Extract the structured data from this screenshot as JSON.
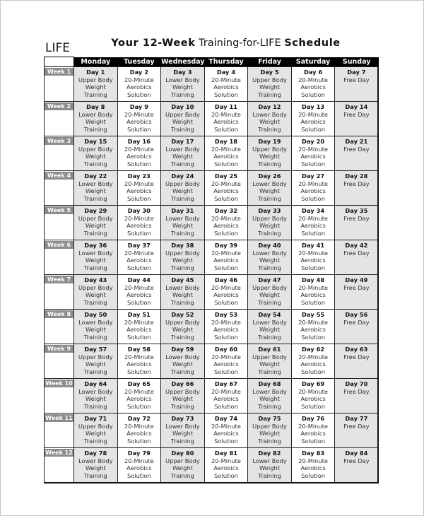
{
  "brand": "LIFE",
  "title": {
    "part1": "Your 12-Week",
    "part2": " Training-for-LIFE ",
    "part3": "Schedule"
  },
  "days_of_week": [
    "Monday",
    "Tuesday",
    "Wednesday",
    "Thursday",
    "Friday",
    "Saturday",
    "Sunday"
  ],
  "weeks": [
    {
      "label": "Week 1",
      "days": [
        {
          "day": "Day 1",
          "lines": [
            "Upper Body",
            "Weight",
            "Training"
          ]
        },
        {
          "day": "Day 2",
          "lines": [
            "20-Minute",
            "Aerobics",
            "Solution"
          ]
        },
        {
          "day": "Day 3",
          "lines": [
            "Lower Body",
            "Weight",
            "Training"
          ]
        },
        {
          "day": "Day 4",
          "lines": [
            "20-Minute",
            "Aerobics",
            "Solution"
          ]
        },
        {
          "day": "Day 5",
          "lines": [
            "Upper Body",
            "Weight",
            "Training"
          ]
        },
        {
          "day": "Day 6",
          "lines": [
            "20-Minute",
            "Aerobics",
            "Solution"
          ]
        },
        {
          "day": "Day 7",
          "lines": [
            "Free Day"
          ]
        }
      ]
    },
    {
      "label": "Week 2",
      "days": [
        {
          "day": "Day 8",
          "lines": [
            "Lower Body",
            "Weight",
            "Training"
          ]
        },
        {
          "day": "Day 9",
          "lines": [
            "20-Minute",
            "Aerobics",
            "Solution"
          ]
        },
        {
          "day": "Day 10",
          "lines": [
            "Upper Body",
            "Weight",
            "Training"
          ]
        },
        {
          "day": "Day 11",
          "lines": [
            "20-Minute",
            "Aerobics",
            "Solution"
          ]
        },
        {
          "day": "Day 12",
          "lines": [
            "Lower Body",
            "Weight",
            "Training"
          ]
        },
        {
          "day": "Day 13",
          "lines": [
            "20-Minute",
            "Aerobics",
            "Solution"
          ]
        },
        {
          "day": "Day 14",
          "lines": [
            "Free Day"
          ]
        }
      ]
    },
    {
      "label": "Week 3",
      "days": [
        {
          "day": "Day 15",
          "lines": [
            "Upper Body",
            "Weight",
            "Training"
          ]
        },
        {
          "day": "Day 16",
          "lines": [
            "20-Minute",
            "Aerobics",
            "Solution"
          ]
        },
        {
          "day": "Day 17",
          "lines": [
            "Lower Body",
            "Weight",
            "Training"
          ]
        },
        {
          "day": "Day 18",
          "lines": [
            "20-Minute",
            "Aerobics",
            "Solution"
          ]
        },
        {
          "day": "Day 19",
          "lines": [
            "Upper Body",
            "Weight",
            "Training"
          ]
        },
        {
          "day": "Day 20",
          "lines": [
            "20-Minute",
            "Aerobics",
            "Solution"
          ]
        },
        {
          "day": "Day 21",
          "lines": [
            "Free Day"
          ]
        }
      ]
    },
    {
      "label": "Week 4",
      "days": [
        {
          "day": "Day 22",
          "lines": [
            "Lower Body",
            "Weight",
            "Training"
          ]
        },
        {
          "day": "Day 23",
          "lines": [
            "20-Minute",
            "Aerobics",
            "Solution"
          ]
        },
        {
          "day": "Day 24",
          "lines": [
            "Upper Body",
            "Weight",
            "Training"
          ]
        },
        {
          "day": "Day 25",
          "lines": [
            "20-Minute",
            "Aerobics",
            "Solution"
          ]
        },
        {
          "day": "Day 26",
          "lines": [
            "Lower Body",
            "Weight",
            "Training"
          ]
        },
        {
          "day": "Day 27",
          "lines": [
            "20-Minute",
            "Aerobics",
            "Solution"
          ]
        },
        {
          "day": "Day 28",
          "lines": [
            "Free Day"
          ]
        }
      ]
    },
    {
      "label": "Week 5",
      "days": [
        {
          "day": "Day 29",
          "lines": [
            "Upper Body",
            "Weight",
            "Training"
          ]
        },
        {
          "day": "Day 30",
          "lines": [
            "20-Minute",
            "Aerobics",
            "Solution"
          ]
        },
        {
          "day": "Day 31",
          "lines": [
            "Lower Body",
            "Weight",
            "Training"
          ]
        },
        {
          "day": "Day 32",
          "lines": [
            "20-Minute",
            "Aerobics",
            "Solution"
          ]
        },
        {
          "day": "Day 33",
          "lines": [
            "Upper Body",
            "Weight",
            "Training"
          ]
        },
        {
          "day": "Day 34",
          "lines": [
            "20-Minute",
            "Aerobics",
            "Solution"
          ]
        },
        {
          "day": "Day 35",
          "lines": [
            "Free Day"
          ]
        }
      ]
    },
    {
      "label": "Week 6",
      "days": [
        {
          "day": "Day 36",
          "lines": [
            "Lower Body",
            "Weight",
            "Training"
          ]
        },
        {
          "day": "Day 37",
          "lines": [
            "20-Minute",
            "Aerobics",
            "Solution"
          ]
        },
        {
          "day": "Day 38",
          "lines": [
            "Upper Body",
            "Weight",
            "Training"
          ]
        },
        {
          "day": "Day 39",
          "lines": [
            "20-Minute",
            "Aerobics",
            "Solution"
          ]
        },
        {
          "day": "Day 40",
          "lines": [
            "Lower Body",
            "Weight",
            "Training"
          ]
        },
        {
          "day": "Day 41",
          "lines": [
            "20-Minute",
            "Aerobics",
            "Solution"
          ]
        },
        {
          "day": "Day 42",
          "lines": [
            "Free Day"
          ]
        }
      ]
    },
    {
      "label": "Week 7",
      "days": [
        {
          "day": "Day 43",
          "lines": [
            "Upper Body",
            "Weight",
            "Training"
          ]
        },
        {
          "day": "Day 44",
          "lines": [
            "20-Minute",
            "Aerobics",
            "Solution"
          ]
        },
        {
          "day": "Day 45",
          "lines": [
            "Lower Body",
            "Weight",
            "Training"
          ]
        },
        {
          "day": "Day 46",
          "lines": [
            "20-Minute",
            "Aerobics",
            "Solution"
          ]
        },
        {
          "day": "Day 47",
          "lines": [
            "Upper Body",
            "Weight",
            "Training"
          ]
        },
        {
          "day": "Day 48",
          "lines": [
            "20-Minute",
            "Aerobics",
            "Solution"
          ]
        },
        {
          "day": "Day 49",
          "lines": [
            "Free Day"
          ]
        }
      ]
    },
    {
      "label": "Week 8",
      "days": [
        {
          "day": "Day 50",
          "lines": [
            "Lower Body",
            "Weight",
            "Training"
          ]
        },
        {
          "day": "Day 51",
          "lines": [
            "20-Minute",
            "Aerobics",
            "Solution"
          ]
        },
        {
          "day": "Day 52",
          "lines": [
            "Upper Body",
            "Weight",
            "Training"
          ]
        },
        {
          "day": "Day 53",
          "lines": [
            "20-Minute",
            "Aerobics",
            "Solution"
          ]
        },
        {
          "day": "Day 54",
          "lines": [
            "Lower Body",
            "Weight",
            "Training"
          ]
        },
        {
          "day": "Day 55",
          "lines": [
            "20-Minute",
            "Aerobics",
            "Solution"
          ]
        },
        {
          "day": "Day 56",
          "lines": [
            "Free Day"
          ]
        }
      ]
    },
    {
      "label": "Week 9",
      "days": [
        {
          "day": "Day 57",
          "lines": [
            "Upper Body",
            "Weight",
            "Training"
          ]
        },
        {
          "day": "Day 58",
          "lines": [
            "20-Minute",
            "Aerobics",
            "Solution"
          ]
        },
        {
          "day": "Day 59",
          "lines": [
            "Lower Body",
            "Weight",
            "Training"
          ]
        },
        {
          "day": "Day 60",
          "lines": [
            "20-Minute",
            "Aerobics",
            "Solution"
          ]
        },
        {
          "day": "Day 61",
          "lines": [
            "Upper Body",
            "Weight",
            "Training"
          ]
        },
        {
          "day": "Day 62",
          "lines": [
            "20-Minute",
            "Aerobics",
            "Solution"
          ]
        },
        {
          "day": "Day 63",
          "lines": [
            "Free Day"
          ]
        }
      ]
    },
    {
      "label": "Week 10",
      "days": [
        {
          "day": "Day 64",
          "lines": [
            "Lower Body",
            "Weight",
            "Training"
          ]
        },
        {
          "day": "Day 65",
          "lines": [
            "20-Minute",
            "Aerobics",
            "Solution"
          ]
        },
        {
          "day": "Day 66",
          "lines": [
            "Upper Body",
            "Weight",
            "Training"
          ]
        },
        {
          "day": "Day 67",
          "lines": [
            "20-Minute",
            "Aerobics",
            "Solution"
          ]
        },
        {
          "day": "Day 68",
          "lines": [
            "Lower Body",
            "Weight",
            "Training"
          ]
        },
        {
          "day": "Day 69",
          "lines": [
            "20-Minute",
            "Aerobics",
            "Solution"
          ]
        },
        {
          "day": "Day 70",
          "lines": [
            "Free Day"
          ]
        }
      ]
    },
    {
      "label": "Week 11",
      "days": [
        {
          "day": "Day 71",
          "lines": [
            "Upper Body",
            "Weight",
            "Training"
          ]
        },
        {
          "day": "Day 72",
          "lines": [
            "20-Minute",
            "Aerobics",
            "Solution"
          ]
        },
        {
          "day": "Day 73",
          "lines": [
            "Lower Body",
            "Weight",
            "Training"
          ]
        },
        {
          "day": "Day 74",
          "lines": [
            "20-Minute",
            "Aerobics",
            "Solution"
          ]
        },
        {
          "day": "Day 75",
          "lines": [
            "Upper Body",
            "Weight",
            "Training"
          ]
        },
        {
          "day": "Day 76",
          "lines": [
            "20-Minute",
            "Aerobics",
            "Solution"
          ]
        },
        {
          "day": "Day 77",
          "lines": [
            "Free Day"
          ]
        }
      ]
    },
    {
      "label": "Week 12",
      "days": [
        {
          "day": "Day 78",
          "lines": [
            "Lower Body",
            "Weight",
            "Training"
          ]
        },
        {
          "day": "Day 79",
          "lines": [
            "20-Minute",
            "Aerobics",
            "Solution"
          ]
        },
        {
          "day": "Day 80",
          "lines": [
            "Upper Body",
            "Weight",
            "Training"
          ]
        },
        {
          "day": "Day 81",
          "lines": [
            "20-Minute",
            "Aerobics",
            "Solution"
          ]
        },
        {
          "day": "Day 82",
          "lines": [
            "Lower Body",
            "Weight",
            "Training"
          ]
        },
        {
          "day": "Day 83",
          "lines": [
            "20-Minute",
            "Aerobics",
            "Solution"
          ]
        },
        {
          "day": "Day 84",
          "lines": [
            "Free Day"
          ]
        }
      ]
    }
  ],
  "colors": {
    "header_bg": "#000000",
    "week_label_bg": "#8c8c8c",
    "shaded_cell": "#e4e4e4"
  }
}
